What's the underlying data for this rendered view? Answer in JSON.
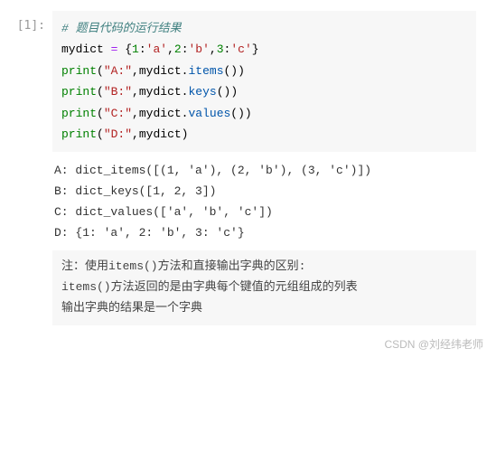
{
  "prompt": "[1]:",
  "watermark": "CSDN @刘经纬老师",
  "code": {
    "comment": "# 题目代码的运行结果",
    "line2": {
      "var": "mydict",
      "op": " = ",
      "open": "{",
      "k1": "1",
      "c1": ":",
      "v1": "'a'",
      "s1": ",",
      "k2": "2",
      "c2": ":",
      "v2": "'b'",
      "s2": ",",
      "k3": "3",
      "c3": ":",
      "v3": "'c'",
      "close": "}"
    },
    "line3": {
      "fn": "print",
      "open": "(",
      "str": "\"A:\"",
      "comma": ",",
      "obj": "mydict",
      "dot": ".",
      "method": "items",
      "call": "()",
      "close": ")"
    },
    "line4": {
      "fn": "print",
      "open": "(",
      "str": "\"B:\"",
      "comma": ",",
      "obj": "mydict",
      "dot": ".",
      "method": "keys",
      "call": "()",
      "close": ")"
    },
    "line5": {
      "fn": "print",
      "open": "(",
      "str": "\"C:\"",
      "comma": ",",
      "obj": "mydict",
      "dot": ".",
      "method": "values",
      "call": "()",
      "close": ")"
    },
    "line6": {
      "fn": "print",
      "open": "(",
      "str": "\"D:\"",
      "comma": ",",
      "obj": "mydict",
      "close": ")"
    }
  },
  "output": {
    "l1": "A: dict_items([(1, 'a'), (2, 'b'), (3, 'c')])",
    "l2": "B: dict_keys([1, 2, 3])",
    "l3": "C: dict_values(['a', 'b', 'c'])",
    "l4": "D: {1: 'a', 2: 'b', 3: 'c'}"
  },
  "note": {
    "l1": "注：使用items()方法和直接输出字典的区别:",
    "l2": "items()方法返回的是由字典每个键值的元组组成的列表",
    "l3": "输出字典的结果是一个字典"
  }
}
